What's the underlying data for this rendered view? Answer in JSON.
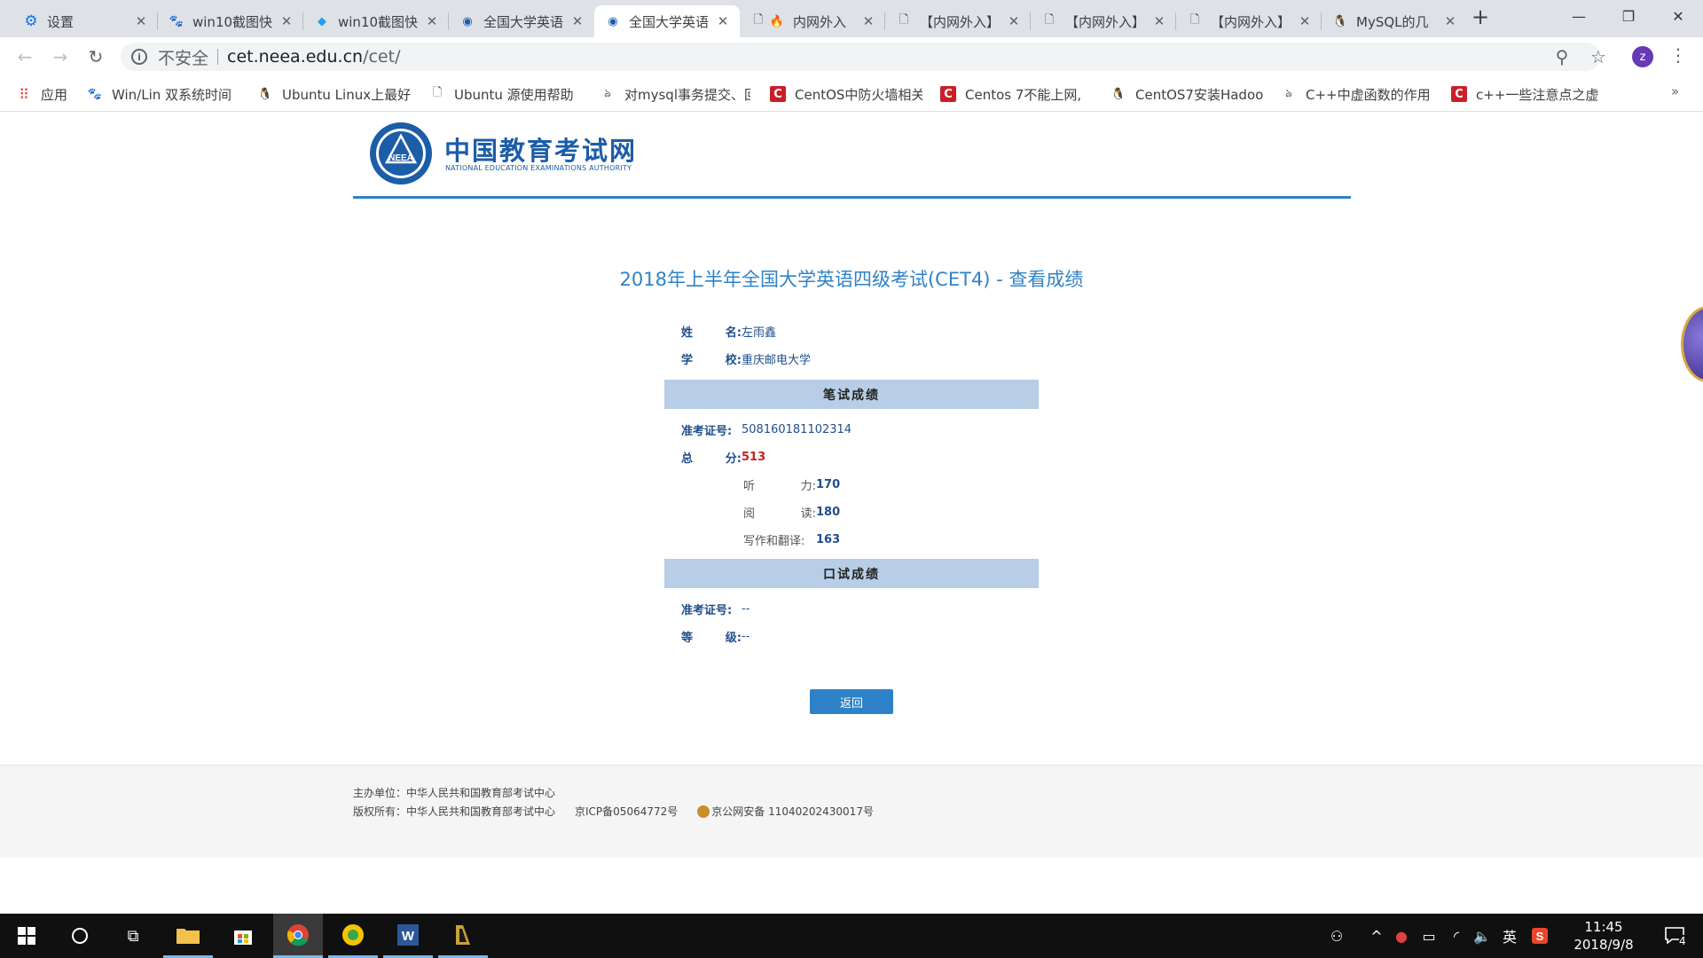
{
  "browser": {
    "tabs": [
      {
        "label": "设置",
        "favicon": "gear-icon"
      },
      {
        "label": "win10截图快",
        "favicon": "baidu-paw-icon"
      },
      {
        "label": "win10截图快",
        "favicon": "diamond-icon"
      },
      {
        "label": "全国大学英语",
        "favicon": "neea-icon"
      },
      {
        "label": "全国大学英语",
        "favicon": "neea-icon",
        "active": true
      },
      {
        "label": "内网外入",
        "favicon": "fire-icon"
      },
      {
        "label": "【内网外入】",
        "favicon": "doc-icon"
      },
      {
        "label": "【内网外入】",
        "favicon": "doc-icon"
      },
      {
        "label": "【内网外入】",
        "favicon": "doc-icon"
      },
      {
        "label": "MySQL的几",
        "favicon": "penguin-icon"
      }
    ],
    "new_tab": "+",
    "window_controls": {
      "minimize": "—",
      "restore": "❐",
      "close": "✕"
    },
    "security_label": "不安全",
    "url_host": "cet.neea.edu.cn",
    "url_path": "/cet/",
    "profile_initial": "z",
    "bookmarks": [
      {
        "label": "应用",
        "icon": "apps-grid-icon"
      },
      {
        "label": "Win/Lin 双系统时间",
        "icon": "baidu-paw-icon"
      },
      {
        "label": "Ubuntu Linux上最好",
        "icon": "penguin-icon"
      },
      {
        "label": "Ubuntu 源使用帮助",
        "icon": "doc-icon"
      },
      {
        "label": "对mysql事务提交、回",
        "icon": "feather-icon"
      },
      {
        "label": "CentOS中防火墙相关",
        "icon": "csdn-icon"
      },
      {
        "label": "Centos 7不能上网,",
        "icon": "csdn-icon"
      },
      {
        "label": "CentOS7安装Hadoo",
        "icon": "penguin-icon"
      },
      {
        "label": "C++中虚函数的作用",
        "icon": "feather-icon"
      },
      {
        "label": "c++一些注意点之虚",
        "icon": "csdn-icon"
      }
    ],
    "bookmarks_more": "»"
  },
  "site": {
    "logo_title": "中国教育考试网",
    "logo_subtitle": "NATIONAL EDUCATION EXAMINATIONS AUTHORITY",
    "logo_badge": "NEEA"
  },
  "result": {
    "title": "2018年上半年全国大学英语四级考试(CET4) - 查看成绩",
    "name_label": [
      "姓",
      "名:"
    ],
    "name": "左雨鑫",
    "school_label": [
      "学",
      "校:"
    ],
    "school": "重庆邮电大学",
    "written_section": "笔试成绩",
    "ticket_label": "准考证号:",
    "ticket": "508160181102314",
    "total_label": [
      "总",
      "分:"
    ],
    "total": "513",
    "listening_label": [
      "听",
      "力:"
    ],
    "listening": "170",
    "reading_label": [
      "阅",
      "读:"
    ],
    "reading": "180",
    "writing_label": "写作和翻译:",
    "writing": "163",
    "oral_section": "口试成绩",
    "oral_ticket_label": "准考证号:",
    "oral_ticket": "--",
    "grade_label": [
      "等",
      "级:"
    ],
    "grade": "--",
    "back_button": "返回"
  },
  "footer": {
    "sponsor": "主办单位：中华人民共和国教育部考试中心",
    "copyright": "版权所有：中华人民共和国教育部考试中心",
    "icp": "京ICP备05064772号",
    "police": "京公网安备 11040202430017号"
  },
  "taskbar": {
    "time": "11:45",
    "date": "2018/9/8",
    "ime": "英",
    "notifications": "4"
  }
}
